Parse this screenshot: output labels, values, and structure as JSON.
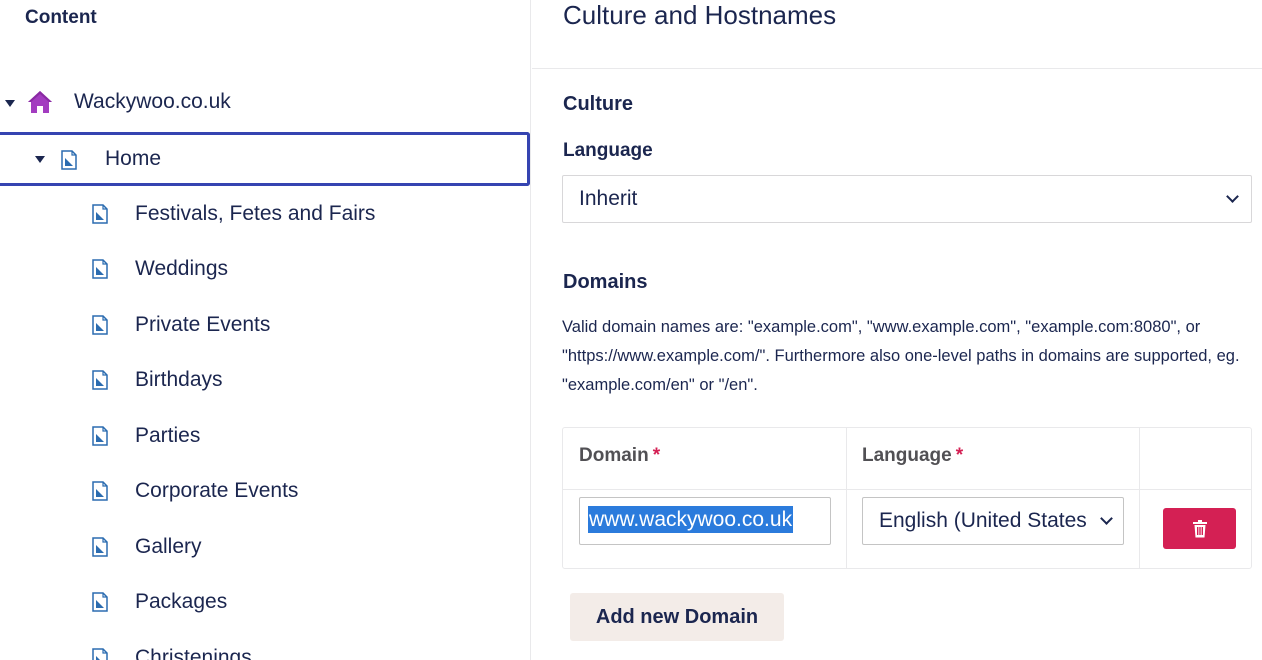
{
  "tree": {
    "header": "Content",
    "root": {
      "label": "Wackywoo.co.uk",
      "icon": "home-icon",
      "expanded": true
    },
    "home": {
      "label": "Home",
      "icon": "document-icon",
      "expanded": true,
      "selected": true
    },
    "children": [
      "Festivals, Fetes and Fairs",
      "Weddings",
      "Private Events",
      "Birthdays",
      "Parties",
      "Corporate Events",
      "Gallery",
      "Packages",
      "Christenings"
    ]
  },
  "main": {
    "title": "Culture and Hostnames",
    "culture": {
      "heading": "Culture",
      "language_label": "Language",
      "language_value": "Inherit"
    },
    "domains": {
      "heading": "Domains",
      "description": "Valid domain names are: \"example.com\", \"www.example.com\", \"example.com:8080\", or \"https://www.example.com/\". Furthermore also one-level paths in domains are supported, eg. \"example.com/en\" or \"/en\".",
      "columns": {
        "domain": "Domain",
        "language": "Language",
        "required_marker": "*"
      },
      "rows": [
        {
          "domain": "www.wackywoo.co.uk",
          "language": "English (United States)"
        }
      ],
      "add_button": "Add new Domain"
    }
  },
  "colors": {
    "text": "#1b264f",
    "home_icon": "#a33cc0",
    "doc_icon": "#2b6cb0",
    "selection_border": "#3544b1",
    "danger": "#d42054",
    "add_button_bg": "#f3ece8",
    "text_selection": "#2b7bdc"
  }
}
